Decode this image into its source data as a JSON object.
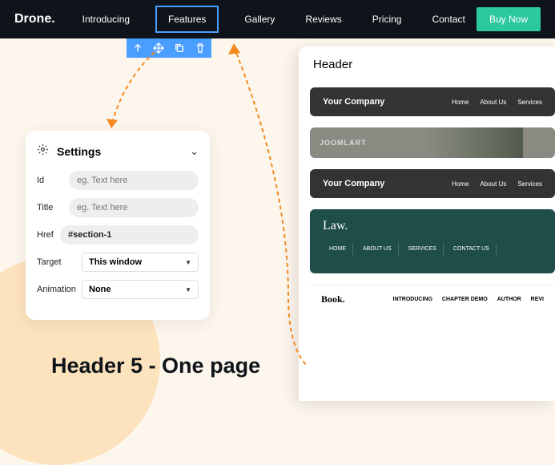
{
  "topnav": {
    "logo": "Drone.",
    "items": [
      "Introducing",
      "Features",
      "Gallery",
      "Reviews",
      "Pricing",
      "Contact"
    ],
    "cta": "Buy Now"
  },
  "toolbar": {
    "icons": [
      "arrow-up-icon",
      "move-icon",
      "copy-icon",
      "delete-icon"
    ]
  },
  "settings": {
    "title": "Settings",
    "fields": {
      "id": {
        "label": "Id",
        "placeholder": "eg. Text here",
        "value": ""
      },
      "title": {
        "label": "Title",
        "placeholder": "eg. Text here",
        "value": ""
      },
      "href": {
        "label": "Href",
        "value": "#section-1"
      },
      "target": {
        "label": "Target",
        "value": "This window"
      },
      "animation": {
        "label": "Animation",
        "value": "None"
      }
    }
  },
  "bottom_title": "Header 5 - One page",
  "header_panel": {
    "title": "Header",
    "previews": [
      {
        "brand": "Your Company",
        "links": [
          "Home",
          "About Us",
          "Services"
        ]
      },
      {
        "brand": "JOOMLART"
      },
      {
        "brand": "Your Company",
        "links": [
          "Home",
          "About Us",
          "Services"
        ]
      },
      {
        "brand": "Law.",
        "links": [
          "HOME",
          "ABOUT US",
          "SERVICES",
          "CONTACT US"
        ]
      },
      {
        "brand": "Book.",
        "links": [
          "INTRODUCING",
          "CHAPTER DEMO",
          "AUTHOR",
          "REVI"
        ]
      }
    ]
  }
}
